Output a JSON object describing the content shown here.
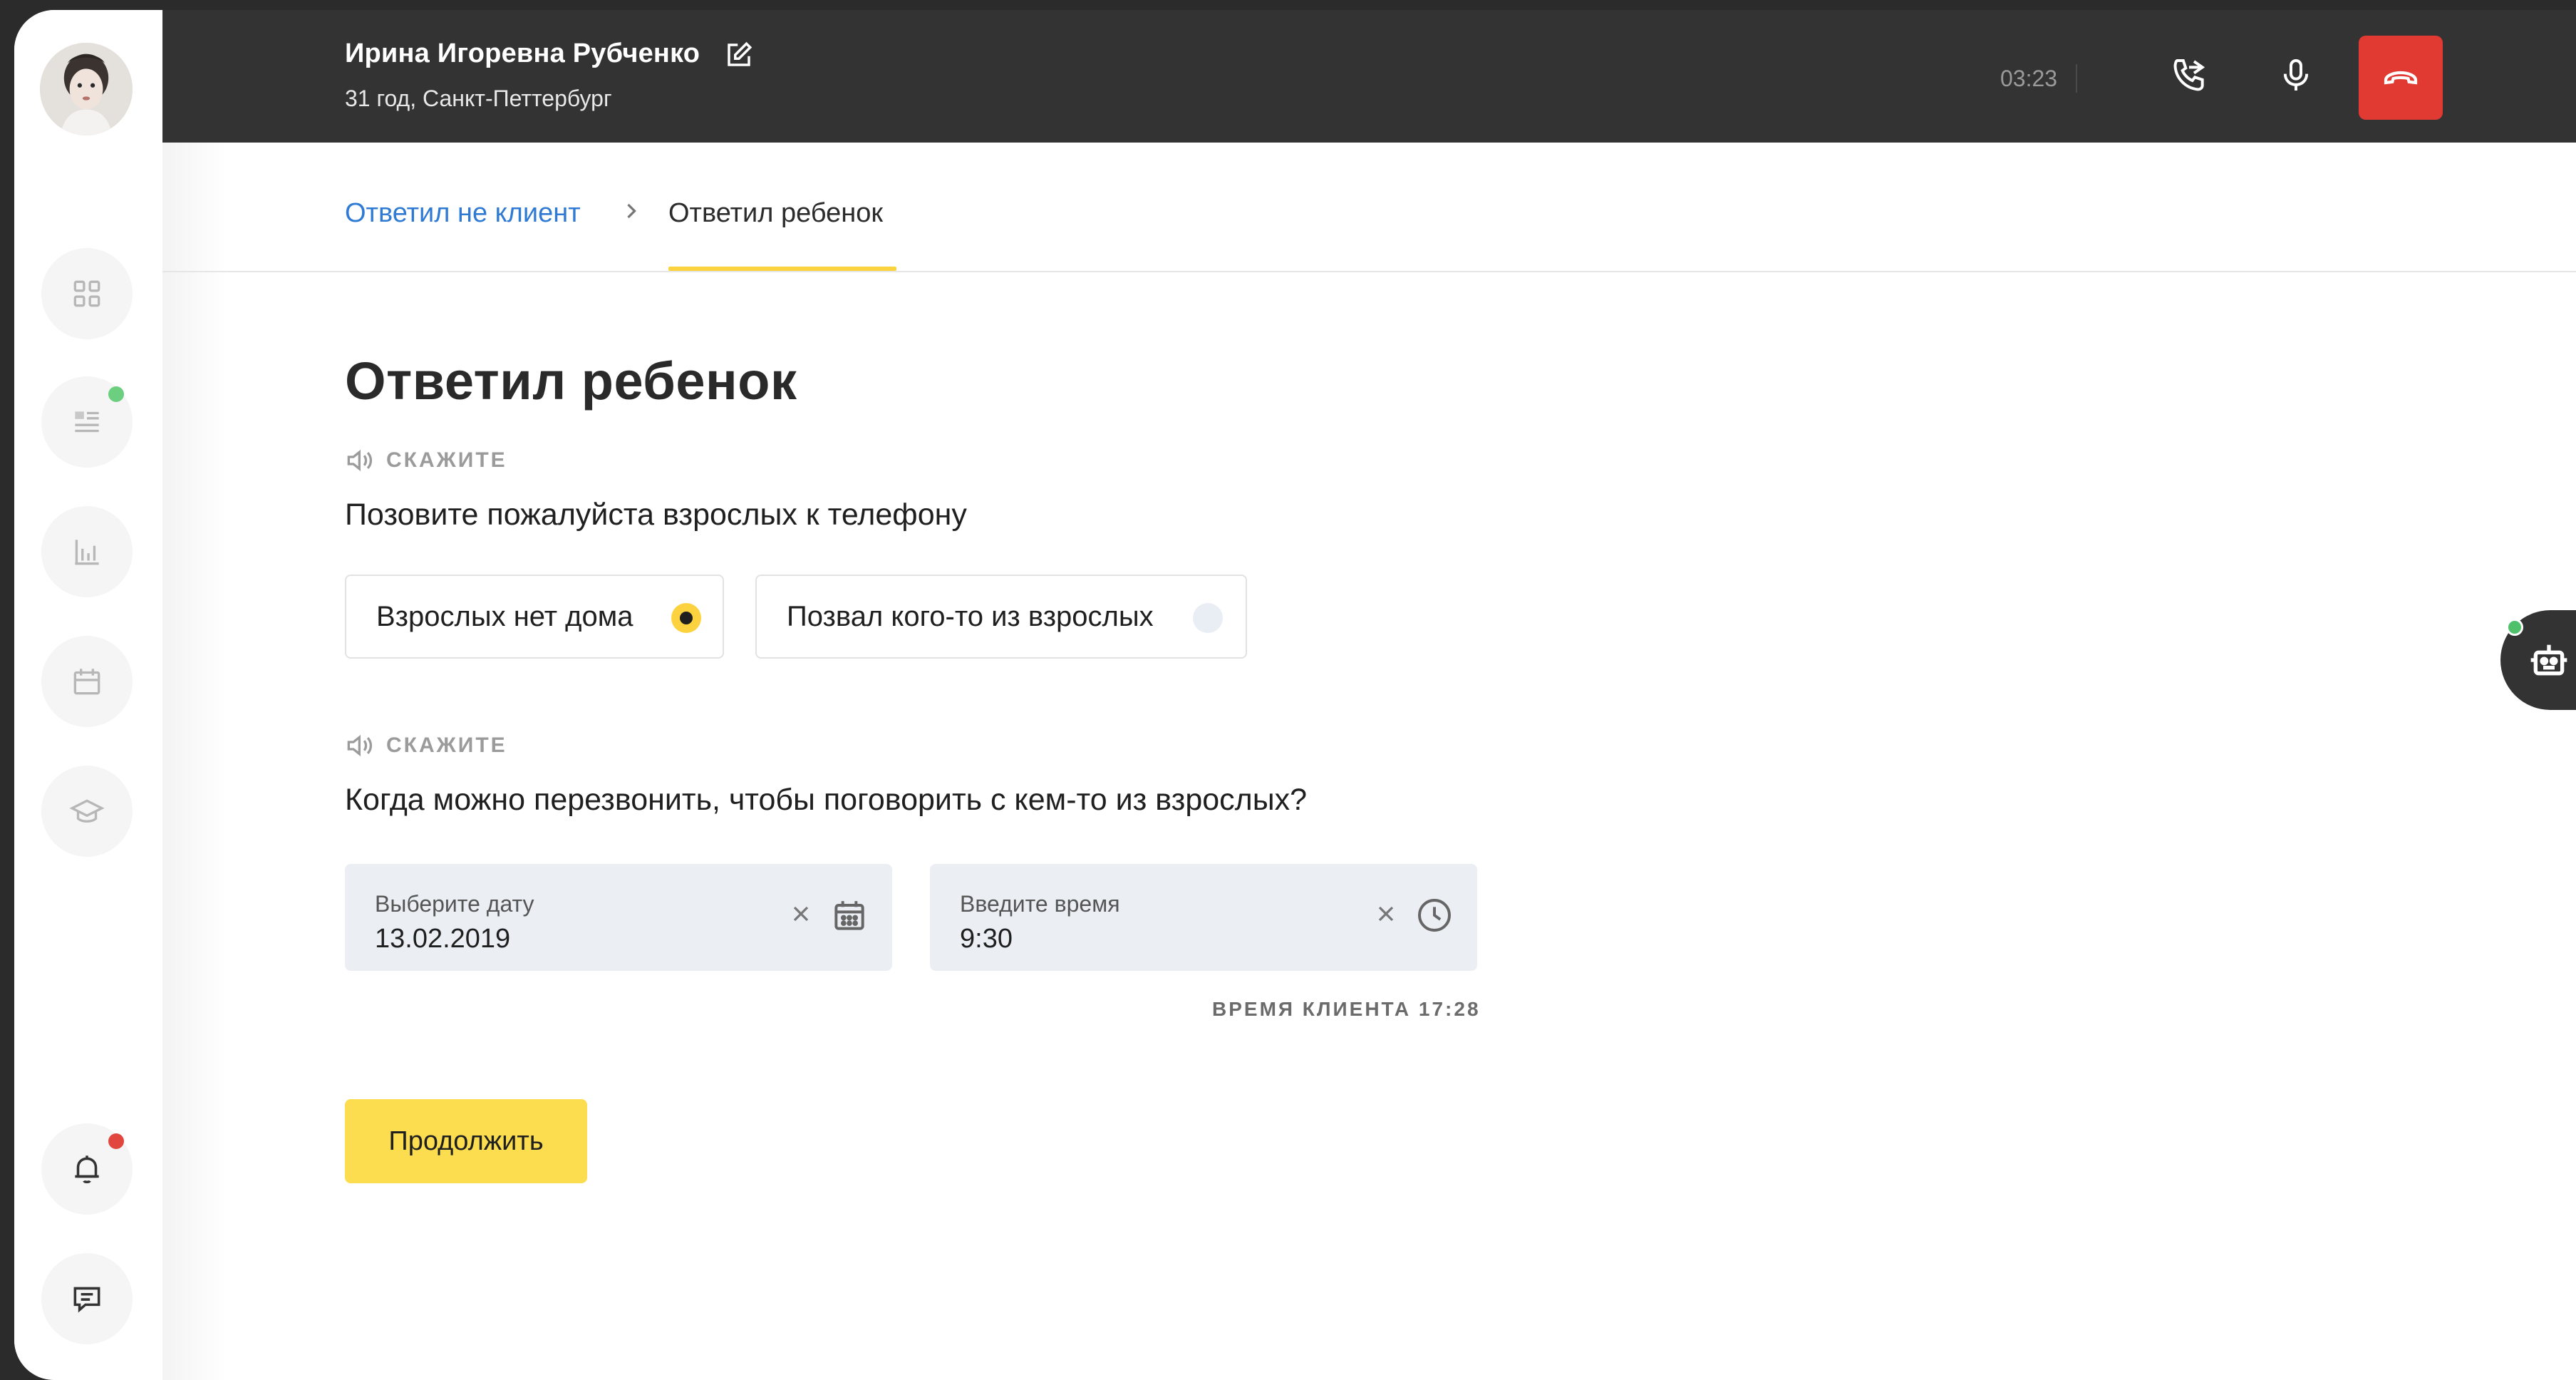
{
  "client": {
    "name": "Ирина Игоревна Рубченко",
    "subtitle": "31 год, Санкт-Петтербург"
  },
  "call": {
    "timer": "03:23",
    "hangup_color": "#e13a32"
  },
  "sidebar": {
    "items": [
      {
        "icon": "grid-icon"
      },
      {
        "icon": "list-icon",
        "badge_color": "#6cce7f"
      },
      {
        "icon": "bar-chart-icon"
      },
      {
        "icon": "calendar-icon"
      },
      {
        "icon": "graduation-cap-icon"
      },
      {
        "icon": "bell-icon",
        "badge_color": "#e1473f"
      },
      {
        "icon": "chat-icon"
      }
    ]
  },
  "breadcrumb": {
    "parent": "Ответил не клиент",
    "current": "Ответил ребенок",
    "accent": "#fcd33f"
  },
  "main": {
    "title": "Ответил ребенок",
    "say_label": "СКАЖИТЕ",
    "prompt1": "Позовите пожалуйста взрослых к телефону",
    "options": [
      {
        "label": "Взрослых нет дома",
        "selected": true
      },
      {
        "label": "Позвал кого-то из взрослых",
        "selected": false
      }
    ],
    "prompt2": "Когда можно перезвонить, чтобы поговорить с кем-то из взрослых?",
    "date_field": {
      "label": "Выберите дату",
      "value": "13.02.2019"
    },
    "time_field": {
      "label": "Введите время",
      "value": "9:30"
    },
    "client_time": "ВРЕМЯ КЛИЕНТА 17:28",
    "continue_label": "Продолжить",
    "button_color": "#fcdd4f"
  }
}
